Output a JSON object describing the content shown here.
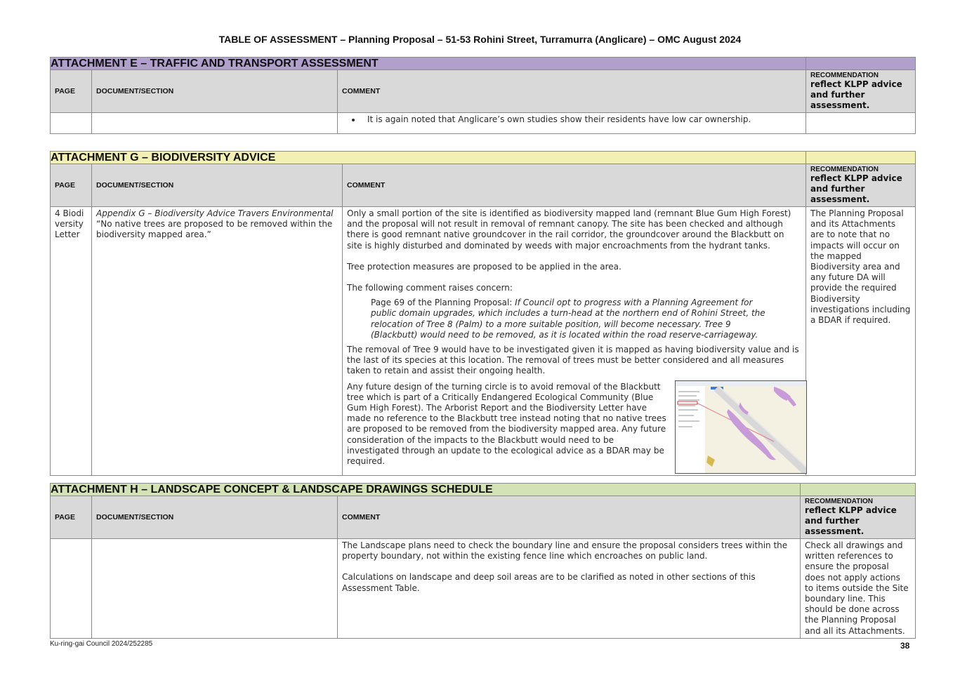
{
  "document_title": "TABLE OF ASSESSMENT – Planning Proposal – 51-53 Rohini Street, Turramurra (Anglicare) – OMC August 2024",
  "colors": {
    "att_e_band": "#b1a0cc",
    "att_g_band": "#f2f0b4",
    "att_h_band": "#d3e3b5",
    "header_grey": "#d9d9d9"
  },
  "headers": {
    "page": "PAGE",
    "document_section": "DOCUMENT/SECTION",
    "comment": "COMMENT",
    "recommendation_small": "RECOMMENDATION",
    "recommendation_big": "reflect KLPP advice and further assessment."
  },
  "attachment_e": {
    "title": "ATTACHMENT E – TRAFFIC AND TRANSPORT ASSESSMENT",
    "rows": [
      {
        "page": "",
        "section": "",
        "comment_bullet": "It is again noted that Anglicare’s own studies show their residents have low car ownership.",
        "recommendation": ""
      }
    ]
  },
  "attachment_g": {
    "title": "ATTACHMENT G – BIODIVERSITY ADVICE",
    "row": {
      "page": "4 Biodiversity Letter",
      "section_italic": "Appendix G – Biodiversity Advice Travers Environmental",
      "section_quote": "“No native trees are proposed to be removed within the biodiversity mapped area.”",
      "comment_p1": "Only a small portion of the site is identified as biodiversity mapped land (remnant Blue Gum High Forest) and the proposal will not result in removal of remnant canopy. The site has been checked and although there is good remnant native groundcover in the rail corridor, the groundcover around the Blackbutt on site is highly disturbed and dominated by weeds with major encroachments from the hydrant tanks.",
      "comment_p2": "Tree protection measures are proposed to be applied in the area.",
      "comment_p3": "The following comment raises concern:",
      "quote_lead": "Page 69 of the Planning Proposal: ",
      "quote_italic": "If Council opt to progress with a Planning Agreement for public domain upgrades, which includes a turn-head at the northern end of Rohini Street, the relocation of Tree 8 (Palm) to a more suitable position, will become necessary. Tree 9 (Blackbutt) would need to be removed, as it is located within the road reserve-carriageway.",
      "comment_p4": "The removal of Tree 9 would have to be investigated given it is mapped as having biodiversity value and is the last of its species at this location. The removal of trees must be better considered and all measures taken to retain and assist their ongoing health.",
      "comment_p5": "Any future design of the turning circle is to avoid removal of the Blackbutt tree which is part of a Critically Endangered Ecological Community (Blue Gum High Forest). The Arborist Report and the Biodiversity Letter have made no reference to the Blackbutt tree instead noting that no native trees are proposed to be removed from the biodiversity mapped area. Any future consideration of the impacts to the Blackbutt would need to be investigated through an update to the ecological advice as a BDAR may be required.",
      "recommendation": "The Planning Proposal and its Attachments are to note that no impacts will occur on the mapped Biodiversity area and any future DA will provide the required Biodiversity investigations including a BDAR if required."
    }
  },
  "attachment_h": {
    "title": "ATTACHMENT H – LANDSCAPE CONCEPT & LANDSCAPE DRAWINGS SCHEDULE",
    "row": {
      "page": "",
      "section": "",
      "comment_p1": "The Landscape plans need to check the boundary line and ensure the proposal considers trees within the property boundary, not within the existing fence line which encroaches on public land.",
      "comment_p2": "Calculations on landscape and deep soil areas are to be clarified as noted in other sections of this Assessment Table.",
      "recommendation": "Check all drawings and written references to ensure the proposal does not apply actions to items outside the Site boundary line. This should be done across the Planning Proposal and all its Attachments."
    }
  },
  "footer": {
    "left": "Ku-ring-gai Council 2024/252285",
    "page_number": "38"
  }
}
